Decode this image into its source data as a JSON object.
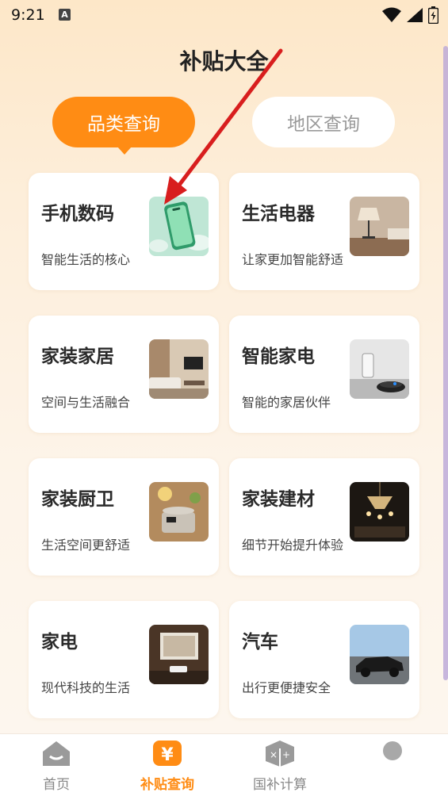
{
  "status": {
    "time": "9:21",
    "notif_badge": "A"
  },
  "page": {
    "title": "补贴大全"
  },
  "tabs": [
    {
      "label": "品类查询",
      "active": true
    },
    {
      "label": "地区查询",
      "active": false
    }
  ],
  "cards": [
    {
      "title": "手机数码",
      "subtitle": "智能生活的核心",
      "image": "smartphone"
    },
    {
      "title": "生活电器",
      "subtitle": "让家更加智能舒适",
      "image": "lamp"
    },
    {
      "title": "家装家居",
      "subtitle": "空间与生活融合",
      "image": "living-room"
    },
    {
      "title": "智能家电",
      "subtitle": "智能的家居伙伴",
      "image": "robot-vacuum"
    },
    {
      "title": "家装厨卫",
      "subtitle": "生活空间更舒适",
      "image": "kitchen"
    },
    {
      "title": "家装建材",
      "subtitle": "细节开始提升体验",
      "image": "chandelier"
    },
    {
      "title": "家电",
      "subtitle": "现代科技的生活",
      "image": "projector"
    },
    {
      "title": "汽车",
      "subtitle": "出行更便捷安全",
      "image": "car"
    }
  ],
  "nav": [
    {
      "label": "首页",
      "icon": "home-icon",
      "active": false
    },
    {
      "label": "补贴查询",
      "icon": "yuan-icon",
      "active": true
    },
    {
      "label": "国补计算",
      "icon": "calculator-icon",
      "active": false
    },
    {
      "label": "",
      "icon": "profile-icon",
      "active": false
    }
  ],
  "colors": {
    "accent": "#ff8c14",
    "annotation_arrow": "#d81e1e"
  }
}
